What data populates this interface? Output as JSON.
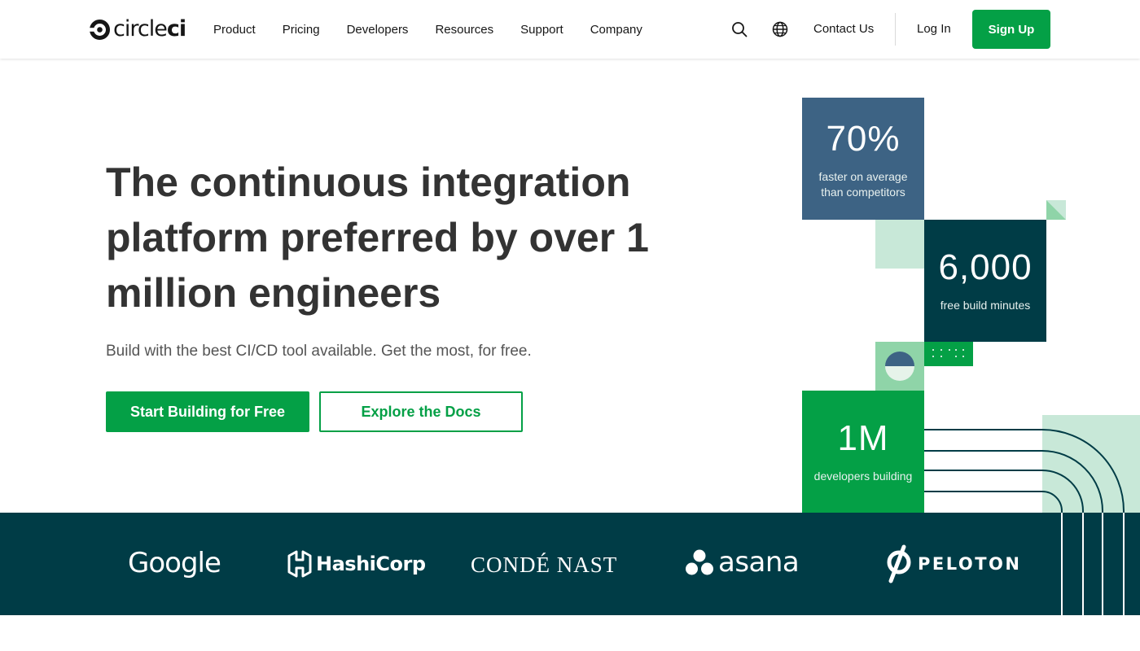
{
  "header": {
    "logo_text_light": "circle",
    "logo_text_bold": "ci",
    "nav": [
      "Product",
      "Pricing",
      "Developers",
      "Resources",
      "Support",
      "Company"
    ],
    "contact_label": "Contact Us",
    "login_label": "Log In",
    "signup_label": "Sign Up",
    "icons": [
      "search-icon",
      "globe-icon"
    ]
  },
  "hero": {
    "title": "The continuous integration platform preferred by over 1 million engineers",
    "subtitle": "Build with the best CI/CD tool available. Get the most, for free.",
    "primary_cta": "Start Building for Free",
    "secondary_cta": "Explore the Docs"
  },
  "stats": [
    {
      "value": "70%",
      "label": "faster on average than competitors"
    },
    {
      "value": "6,000",
      "label": "free build minutes"
    },
    {
      "value": "1M",
      "label": "developers building"
    }
  ],
  "brands": [
    "Google",
    "HashiCorp",
    "CONDÉ NAST",
    "asana",
    "PELOTON"
  ],
  "colors": {
    "brand_green": "#04a046",
    "dark_teal": "#003c46",
    "slate_blue": "#3d6384",
    "mint": "#c8e8d8",
    "mid_green": "#8fd4a8"
  }
}
